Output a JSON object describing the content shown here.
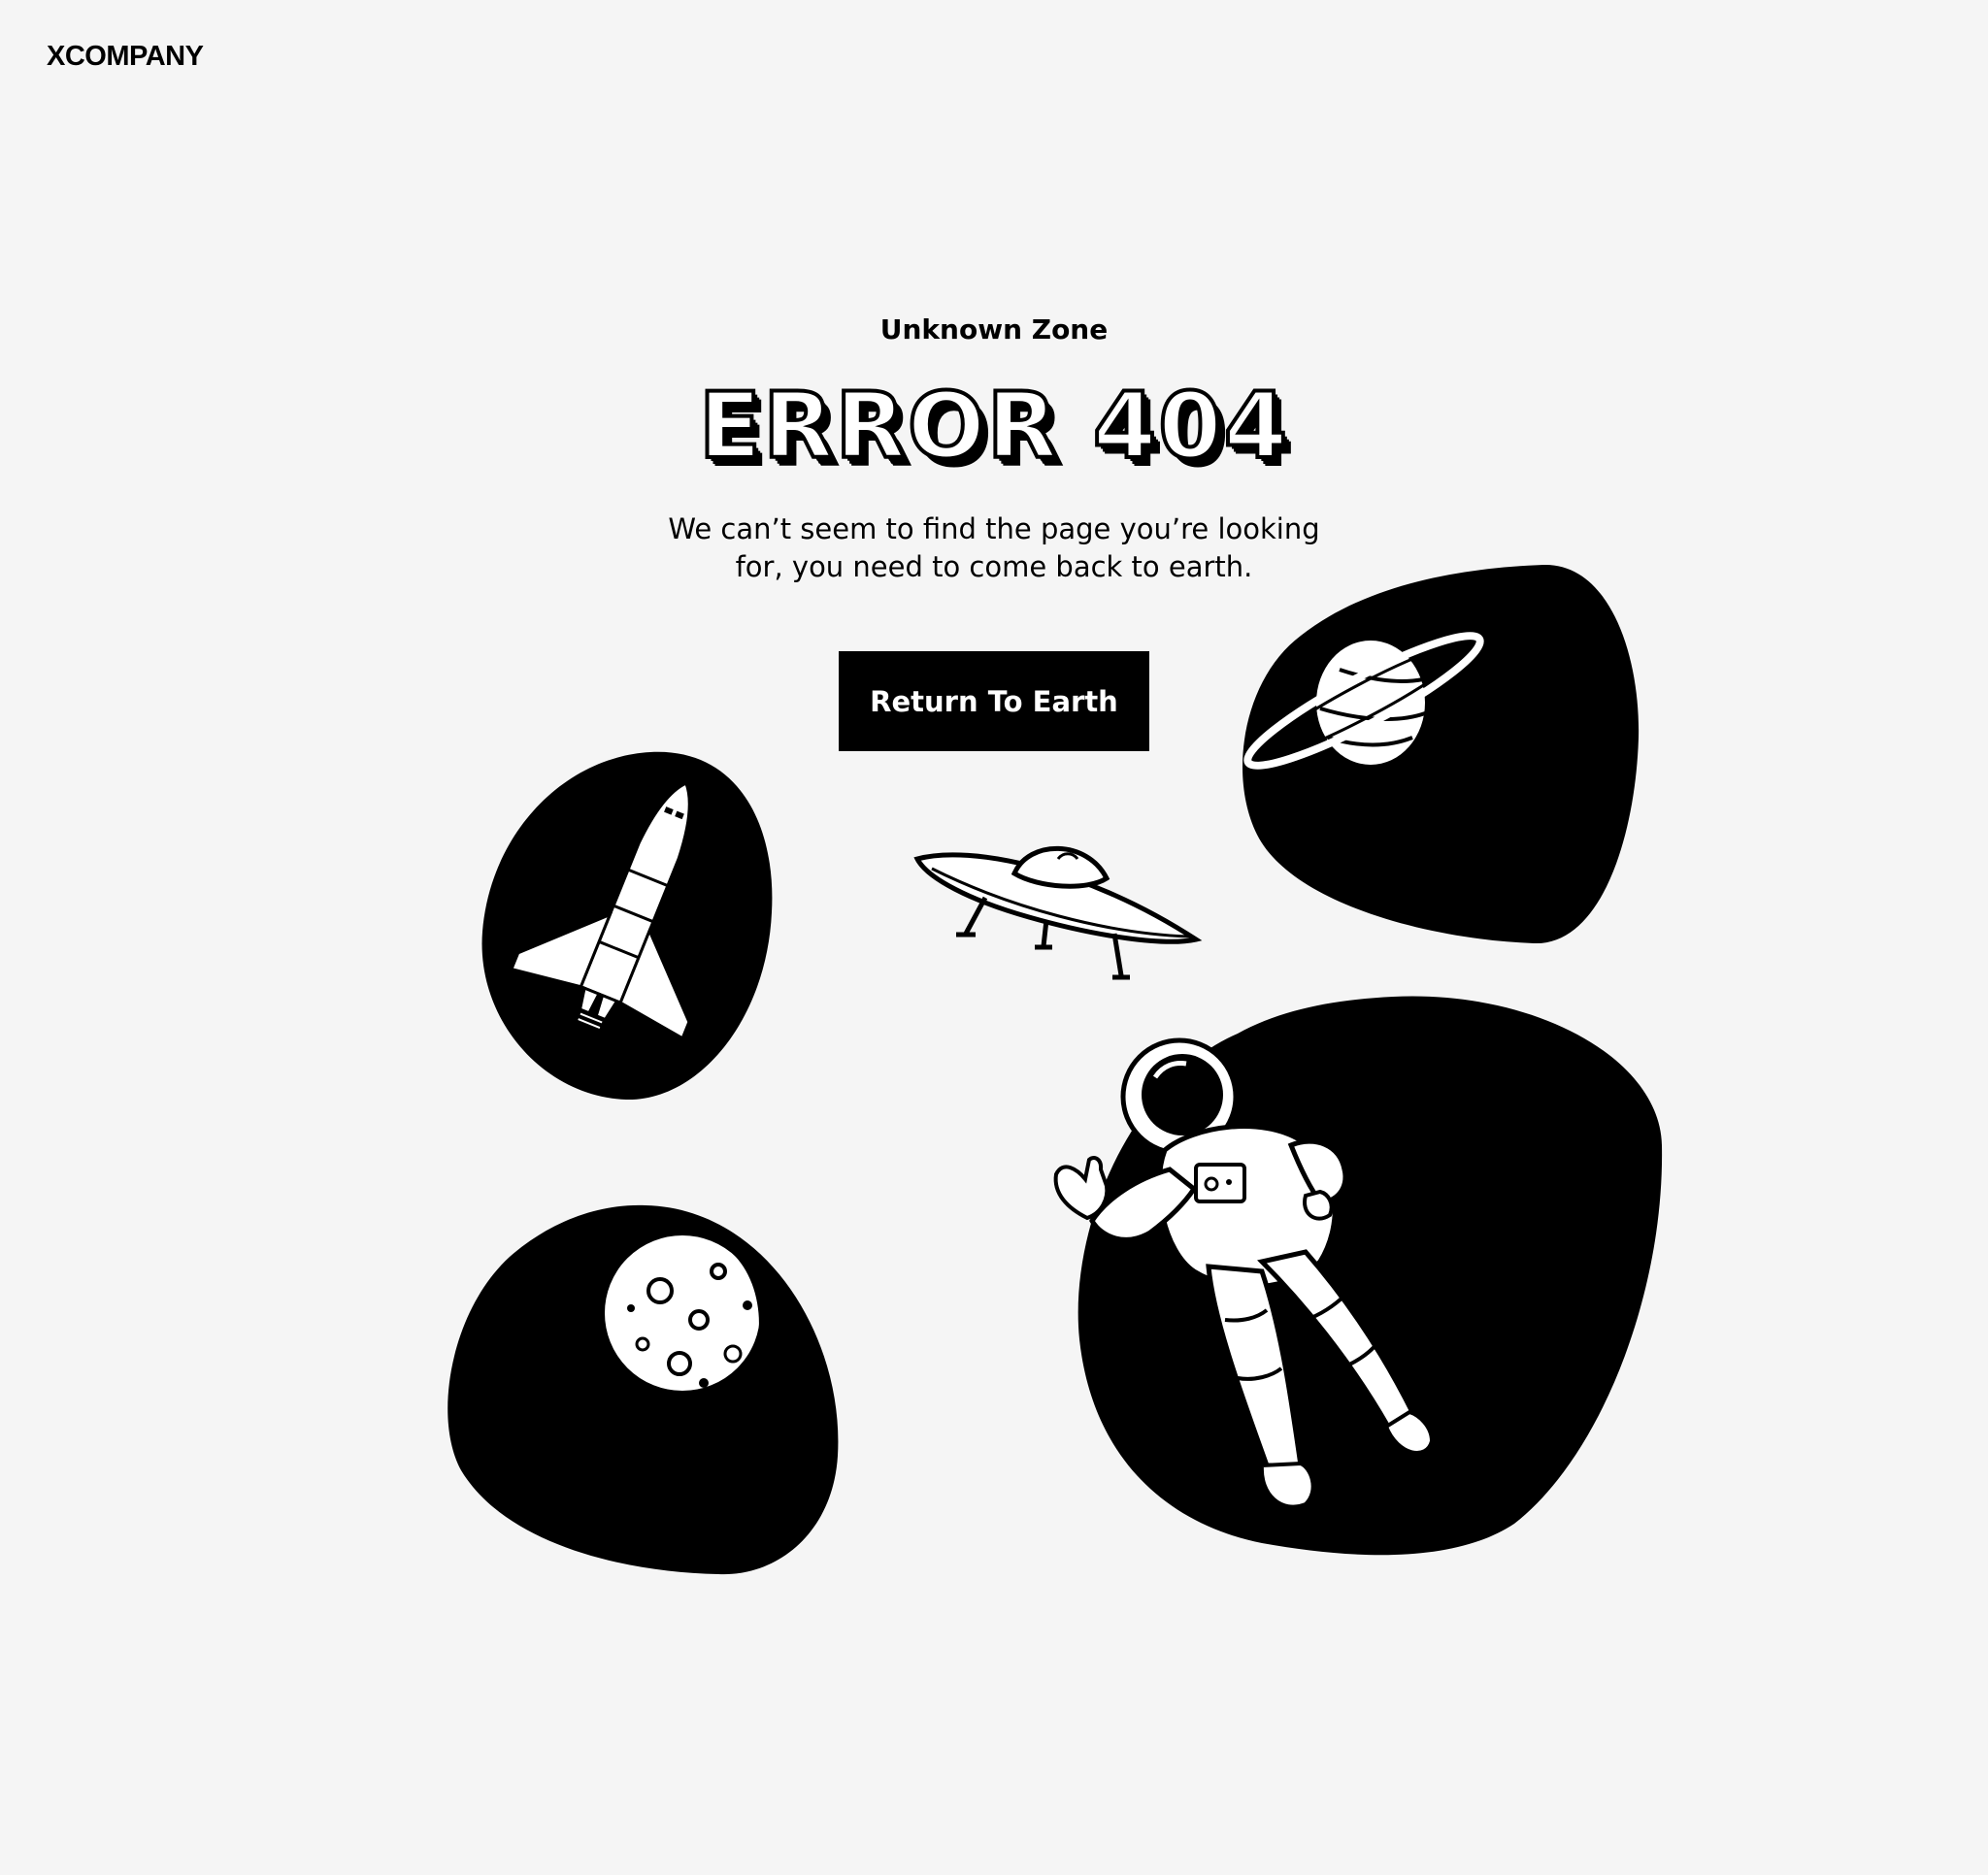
{
  "header": {
    "logo_text": "XCOMPANY"
  },
  "main": {
    "eyebrow": "Unknown Zone",
    "headline": "ERROR 404",
    "message_line1": "We can’t seem to find the page you’re looking",
    "message_line2": "for, you need to come back to earth.",
    "cta_label": "Return To Earth"
  },
  "illustrations": {
    "items": [
      "space-shuttle-icon",
      "ufo-icon",
      "saturn-icon",
      "moon-icon",
      "astronaut-icon"
    ]
  },
  "colors": {
    "background": "#f5f5f5",
    "ink": "#000000",
    "paper": "#ffffff"
  }
}
